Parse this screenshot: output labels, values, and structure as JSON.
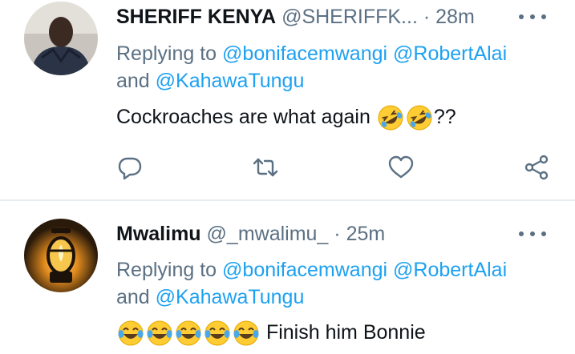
{
  "tweets": [
    {
      "name": "SHERIFF KENYA",
      "handle": "@SHERIFFK...",
      "dot": "·",
      "time": "28m",
      "replying_prefix": "Replying to",
      "mention1": "@bonifacemwangi",
      "mention2": "@RobertAlai",
      "and_text": "and",
      "mention3": "@KahawaTungu",
      "text_before": "Cockroaches are what again",
      "text_after": "??",
      "emoji": "rolling-on-floor-laughing"
    },
    {
      "name": "Mwalimu",
      "handle": "@_mwalimu_",
      "dot": "·",
      "time": "25m",
      "replying_prefix": "Replying to",
      "mention1": "@bonifacemwangi",
      "mention2": "@RobertAlai",
      "and_text": "and",
      "mention3": "@KahawaTungu",
      "text_after": "Finish him Bonnie",
      "emoji": "face-with-tears-of-joy"
    }
  ],
  "colors": {
    "link": "#1da1f2",
    "secondary_text": "#5b7083",
    "primary_text": "#0f1419",
    "divider": "#e6ecf0"
  },
  "icons": [
    "reply-icon",
    "retweet-icon",
    "like-icon",
    "share-icon",
    "more-icon"
  ]
}
